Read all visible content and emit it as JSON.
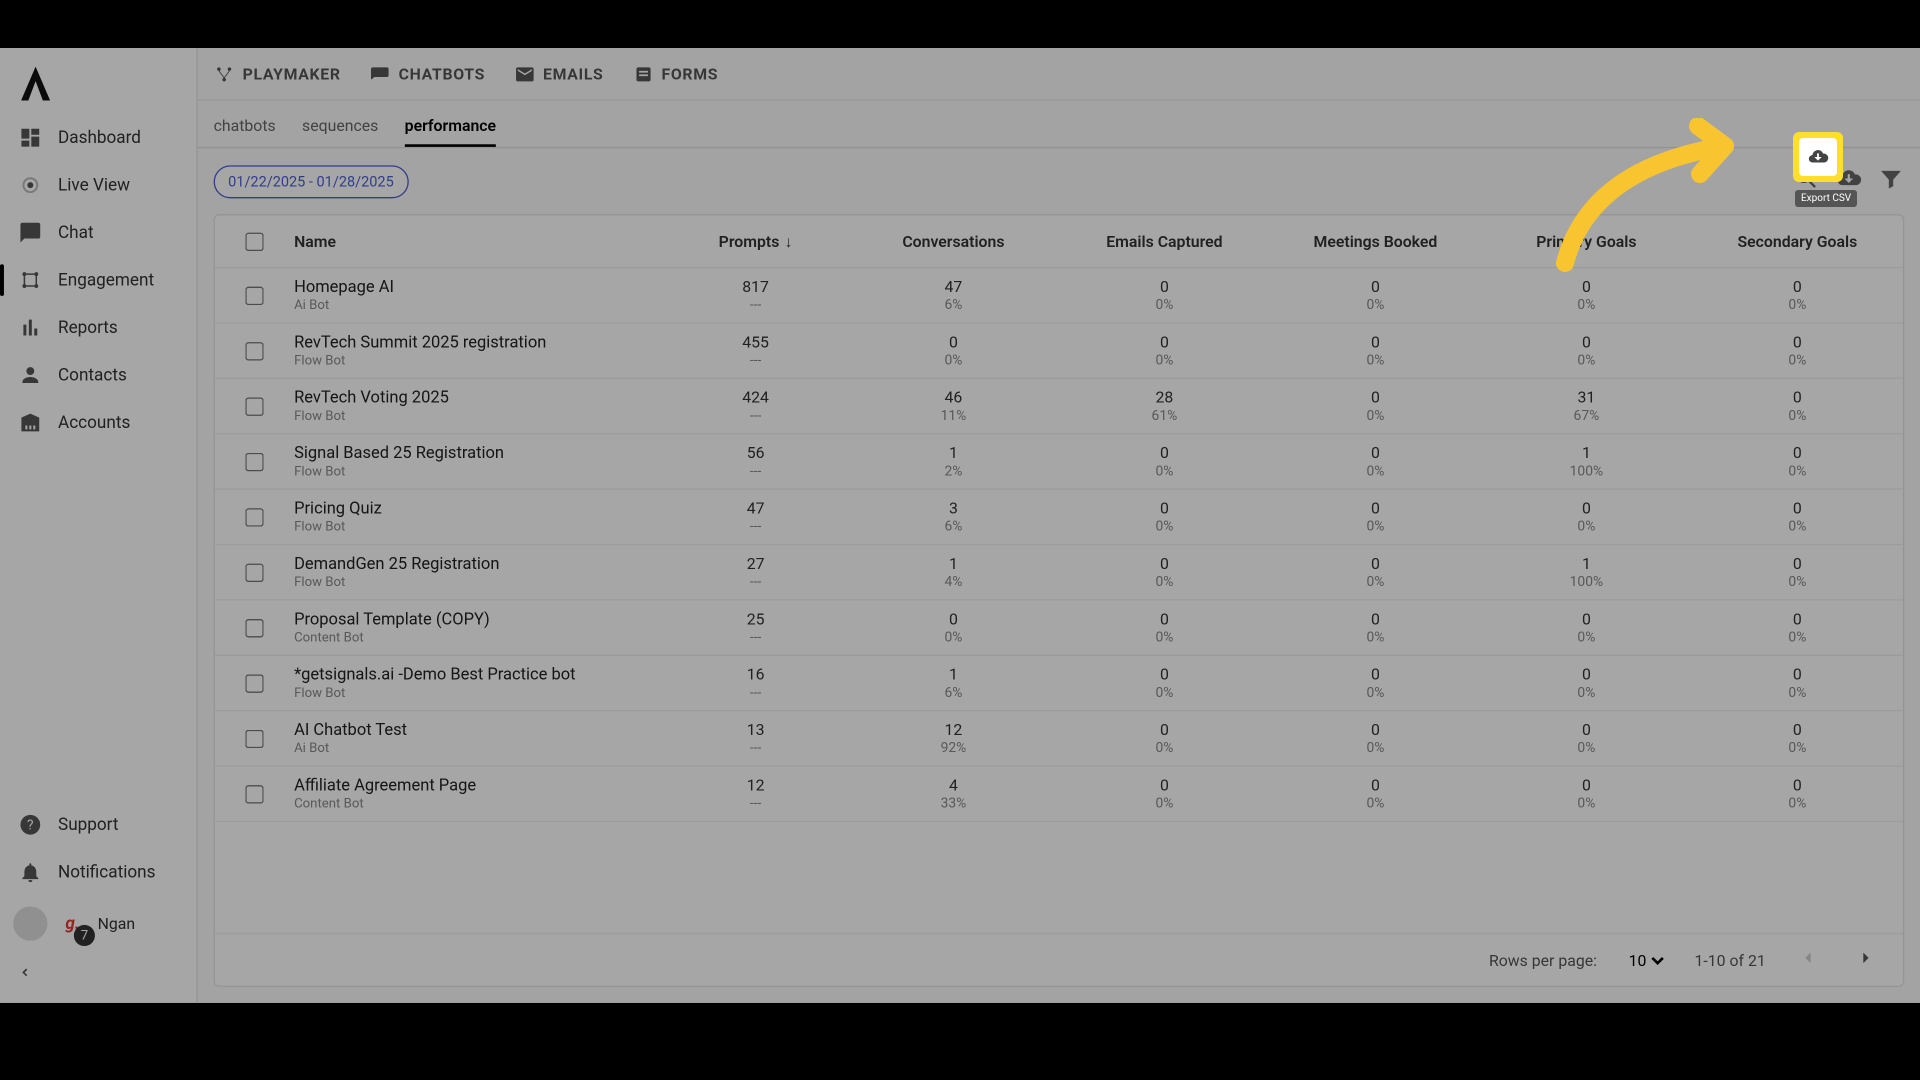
{
  "sidebar": {
    "items": [
      {
        "label": "Dashboard",
        "icon": "dashboard"
      },
      {
        "label": "Live View",
        "icon": "liveview"
      },
      {
        "label": "Chat",
        "icon": "chat"
      },
      {
        "label": "Engagement",
        "icon": "engagement"
      },
      {
        "label": "Reports",
        "icon": "reports"
      },
      {
        "label": "Contacts",
        "icon": "contacts"
      },
      {
        "label": "Accounts",
        "icon": "accounts"
      }
    ],
    "support": "Support",
    "notifications": "Notifications",
    "user": "Ngan",
    "badge": "7"
  },
  "topnav": {
    "tabs": [
      "PLAYMAKER",
      "CHATBOTS",
      "EMAILS",
      "FORMS"
    ]
  },
  "subnav": {
    "tabs": [
      "chatbots",
      "sequences",
      "performance"
    ]
  },
  "toolbar": {
    "date_range": "01/22/2025 - 01/28/2025",
    "tooltip": "Export CSV"
  },
  "table": {
    "headers": [
      "Name",
      "Prompts",
      "Conversations",
      "Emails Captured",
      "Meetings Booked",
      "Primary Goals",
      "Secondary Goals"
    ],
    "rows": [
      {
        "name": "Homepage AI",
        "type": "Ai Bot",
        "prompts": "817",
        "prompts_p": "---",
        "conv": "47",
        "conv_p": "6%",
        "emails": "0",
        "emails_p": "0%",
        "meet": "0",
        "meet_p": "0%",
        "pg": "0",
        "pg_p": "0%",
        "sg": "0",
        "sg_p": "0%"
      },
      {
        "name": "RevTech Summit 2025 registration",
        "type": "Flow Bot",
        "prompts": "455",
        "prompts_p": "---",
        "conv": "0",
        "conv_p": "0%",
        "emails": "0",
        "emails_p": "0%",
        "meet": "0",
        "meet_p": "0%",
        "pg": "0",
        "pg_p": "0%",
        "sg": "0",
        "sg_p": "0%"
      },
      {
        "name": "RevTech Voting 2025",
        "type": "Flow Bot",
        "prompts": "424",
        "prompts_p": "---",
        "conv": "46",
        "conv_p": "11%",
        "emails": "28",
        "emails_p": "61%",
        "meet": "0",
        "meet_p": "0%",
        "pg": "31",
        "pg_p": "67%",
        "sg": "0",
        "sg_p": "0%"
      },
      {
        "name": "Signal Based 25 Registration",
        "type": "Flow Bot",
        "prompts": "56",
        "prompts_p": "---",
        "conv": "1",
        "conv_p": "2%",
        "emails": "0",
        "emails_p": "0%",
        "meet": "0",
        "meet_p": "0%",
        "pg": "1",
        "pg_p": "100%",
        "sg": "0",
        "sg_p": "0%"
      },
      {
        "name": "Pricing Quiz",
        "type": "Flow Bot",
        "prompts": "47",
        "prompts_p": "---",
        "conv": "3",
        "conv_p": "6%",
        "emails": "0",
        "emails_p": "0%",
        "meet": "0",
        "meet_p": "0%",
        "pg": "0",
        "pg_p": "0%",
        "sg": "0",
        "sg_p": "0%"
      },
      {
        "name": "DemandGen 25 Registration",
        "type": "Flow Bot",
        "prompts": "27",
        "prompts_p": "---",
        "conv": "1",
        "conv_p": "4%",
        "emails": "0",
        "emails_p": "0%",
        "meet": "0",
        "meet_p": "0%",
        "pg": "1",
        "pg_p": "100%",
        "sg": "0",
        "sg_p": "0%"
      },
      {
        "name": "Proposal Template (COPY)",
        "type": "Content Bot",
        "prompts": "25",
        "prompts_p": "---",
        "conv": "0",
        "conv_p": "0%",
        "emails": "0",
        "emails_p": "0%",
        "meet": "0",
        "meet_p": "0%",
        "pg": "0",
        "pg_p": "0%",
        "sg": "0",
        "sg_p": "0%"
      },
      {
        "name": "*getsignals.ai -Demo Best Practice bot",
        "type": "Flow Bot",
        "prompts": "16",
        "prompts_p": "---",
        "conv": "1",
        "conv_p": "6%",
        "emails": "0",
        "emails_p": "0%",
        "meet": "0",
        "meet_p": "0%",
        "pg": "0",
        "pg_p": "0%",
        "sg": "0",
        "sg_p": "0%"
      },
      {
        "name": "AI Chatbot Test",
        "type": "Ai Bot",
        "prompts": "13",
        "prompts_p": "---",
        "conv": "12",
        "conv_p": "92%",
        "emails": "0",
        "emails_p": "0%",
        "meet": "0",
        "meet_p": "0%",
        "pg": "0",
        "pg_p": "0%",
        "sg": "0",
        "sg_p": "0%"
      },
      {
        "name": "Affiliate Agreement Page",
        "type": "Content Bot",
        "prompts": "12",
        "prompts_p": "---",
        "conv": "4",
        "conv_p": "33%",
        "emails": "0",
        "emails_p": "0%",
        "meet": "0",
        "meet_p": "0%",
        "pg": "0",
        "pg_p": "0%",
        "sg": "0",
        "sg_p": "0%"
      }
    ]
  },
  "footer": {
    "rpp_label": "Rows per page:",
    "rpp_value": "10",
    "range": "1-10 of 21"
  }
}
